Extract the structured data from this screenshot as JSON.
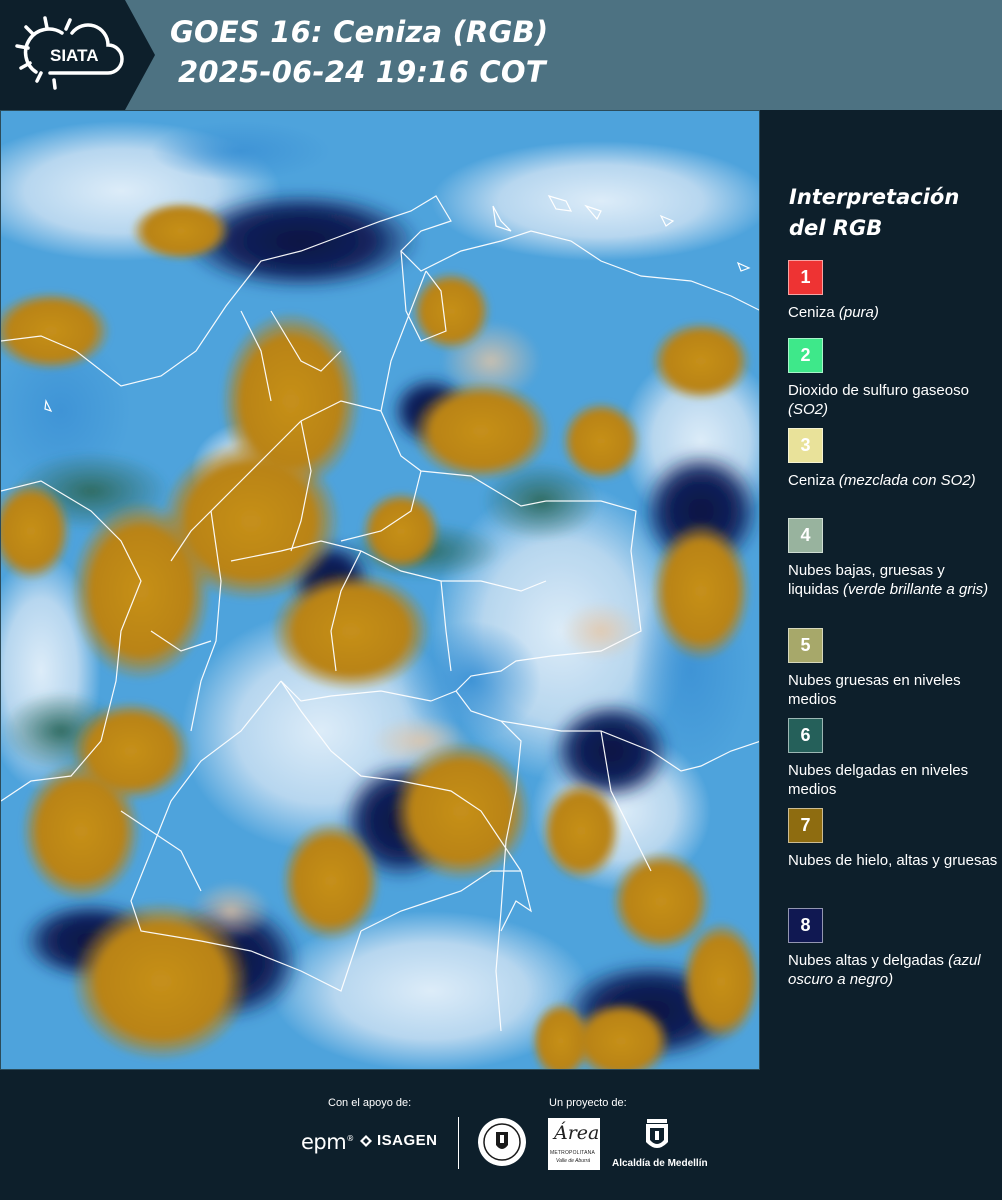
{
  "header": {
    "logo_text": "SIATA",
    "title_line1": "GOES 16: Ceniza (RGB)",
    "title_line2": "2025-06-24 19:16 COT"
  },
  "legend": {
    "title_line1": "Interpretación",
    "title_line2": "del RGB",
    "items": [
      {
        "number": "1",
        "color": "#ee3333",
        "text_color": "#ffffff",
        "label": "Ceniza",
        "note": "(pura)"
      },
      {
        "number": "2",
        "color": "#3ee88a",
        "text_color": "#ffffff",
        "label": "Dioxido de sulfuro gaseoso",
        "note": "(SO2)"
      },
      {
        "number": "3",
        "color": "#e9e29a",
        "text_color": "#ffffff",
        "label": "Ceniza",
        "note": "(mezclada con SO2)"
      },
      {
        "number": "4",
        "color": "#98b39e",
        "text_color": "#ffffff",
        "label": "Nubes bajas, gruesas y liquidas",
        "note": "(verde brillante a gris)"
      },
      {
        "number": "5",
        "color": "#a7a86a",
        "text_color": "#ffffff",
        "label": "Nubes gruesas en niveles medios",
        "note": ""
      },
      {
        "number": "6",
        "color": "#25605a",
        "text_color": "#ffffff",
        "label": "Nubes delgadas en niveles medios",
        "note": ""
      },
      {
        "number": "7",
        "color": "#8e6c10",
        "text_color": "#ffffff",
        "label": "Nubes de hielo, altas y gruesas",
        "note": ""
      },
      {
        "number": "8",
        "color": "#101852",
        "text_color": "#ffffff",
        "label": "Nubes altas y delgadas",
        "note": "(azul oscuro a negro)"
      }
    ]
  },
  "footer": {
    "support_label": "Con el apoyo de:",
    "project_label": "Un proyecto de:",
    "epm": "epm",
    "epm_mark": "®",
    "isagen": "ISAGEN",
    "area_script": "Área",
    "area_sub1": "METROPOLITANA",
    "area_sub2": "Valle de Aburrá",
    "medellin": "Alcaldía de Medellín"
  },
  "colors": {
    "header_bg": "#4d7282",
    "logo_bg": "#0d1f2b",
    "panel_bg": "#0d1f2b",
    "sky_blue": "#4ea3dc",
    "cloud_white": "#cfe4f5",
    "ice_cloud_orange": "#c6901a",
    "deep_navy": "#0e1a50"
  },
  "icons": {
    "logo": "siata-sun-cloud-logo",
    "isagen": "isagen-leaf-icon",
    "seal": "university-seal-icon",
    "medellin": "medellin-crest-icon"
  }
}
